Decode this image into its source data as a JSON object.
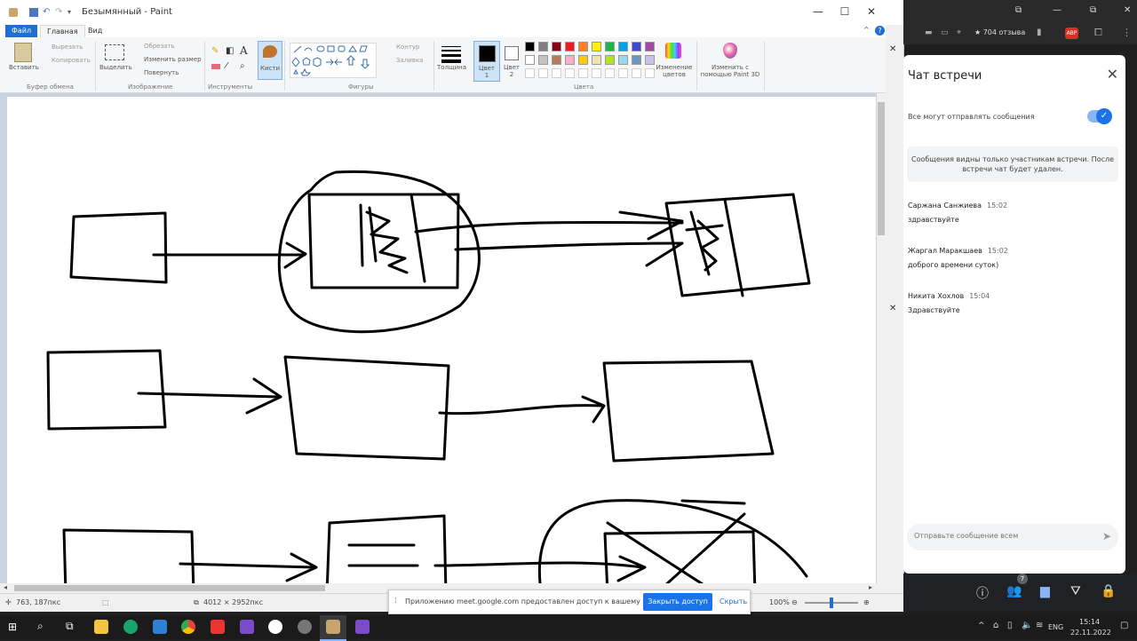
{
  "window": {
    "title": "Безымянный - Paint",
    "minimize": "—",
    "maximize": "☐",
    "close": "✕"
  },
  "tabs": [
    {
      "label": "Файл"
    },
    {
      "label": "Главная"
    },
    {
      "label": "Вид"
    }
  ],
  "ribbon": {
    "clipboard": {
      "paste": "Вставить",
      "cut": "Вырезать",
      "copy": "Копировать",
      "group": "Буфер обмена"
    },
    "image": {
      "select": "Выделить",
      "crop": "Обрезать",
      "resize": "Изменить размер",
      "rotate": "Повернуть",
      "group": "Изображение"
    },
    "tools": {
      "group": "Инструменты",
      "text_tool": "A"
    },
    "brushes": {
      "label": "Кисти"
    },
    "shapes": {
      "outline": "Контур",
      "fill": "Заливка",
      "group": "Фигуры"
    },
    "size": {
      "label": "Толщина"
    },
    "color1": {
      "label": "Цвет 1"
    },
    "color2": {
      "label": "Цвет 2"
    },
    "colors": {
      "group": "Цвета",
      "edit": "Изменение цветов"
    },
    "paint3d": {
      "label": "Изменить с помощью Paint 3D"
    }
  },
  "palette": [
    "#000000",
    "#7f7f7f",
    "#880015",
    "#ed1c24",
    "#ff7f27",
    "#fff200",
    "#22b14c",
    "#00a2e8",
    "#3f48cc",
    "#a349a4",
    "#ffffff",
    "#c3c3c3",
    "#b97a57",
    "#ffaec9",
    "#ffc90e",
    "#efe4b0",
    "#b5e61d",
    "#99d9ea",
    "#7092be",
    "#c8bfe7"
  ],
  "statusbar": {
    "cursor": "763, 187пкс",
    "size": "4012 × 2952пкс",
    "zoom": "100%",
    "zoom_slider": 0.5
  },
  "sharebar": {
    "message": "Приложению meet.google.com предоставлен доступ к вашему экрану.",
    "stop": "Закрыть доступ",
    "hide": "Скрыть"
  },
  "browser": {
    "reviews": "★ 704 отзыва",
    "abp": "ABP"
  },
  "chat": {
    "title": "Чат встречи",
    "toggle_label": "Все могут отправлять сообщения",
    "notice": "Сообщения видны только участникам встречи. После встречи чат будет удален.",
    "messages": [
      {
        "name": "Саржана Санжиева",
        "time": "15:02",
        "text": "здравствуйте"
      },
      {
        "name": "Жаргал Маракшаев",
        "time": "15:02",
        "text": "доброго времени суток)"
      },
      {
        "name": "Никита Хохлов",
        "time": "15:04",
        "text": "Здравствуйте"
      }
    ],
    "input_placeholder": "Отправьте сообщение всем"
  },
  "meet": {
    "participants_badge": "7"
  },
  "taskbar": {
    "lang": "ENG",
    "time": "15:14",
    "date": "22.11.2022"
  }
}
